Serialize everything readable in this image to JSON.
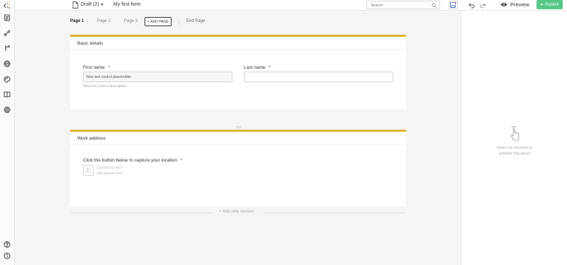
{
  "topbar": {
    "draft_label": "Draft (2)",
    "form_title": "My first form",
    "search_placeholder": "Search",
    "preview_label": "Preview",
    "publish_label": "Publish"
  },
  "pages": {
    "tabs": [
      "Page 1",
      "Page 2",
      "Page 3"
    ],
    "add_page_label": "+ ADD PAGE",
    "end_page_label": "End Page"
  },
  "sections": [
    {
      "title": "Basic details",
      "fields": [
        {
          "label": "First name",
          "required_mark": "*",
          "value": "New text control placeholder",
          "description": "New text control description"
        },
        {
          "label": "Last name",
          "required_mark": "*",
          "value": ""
        }
      ]
    },
    {
      "title": "Work address",
      "capture_label": "Click the button below to capture your location",
      "required_mark": "*",
      "location_hint_line1": "Current location",
      "location_hint_line2": "will appear here"
    }
  ],
  "add_section_label": "+ Add new section",
  "right_panel": {
    "message_line1": "Select an element to",
    "message_line2": "activate this panel"
  },
  "colors": {
    "section_accent": "#e0b532",
    "publish_bg": "#57c785"
  }
}
